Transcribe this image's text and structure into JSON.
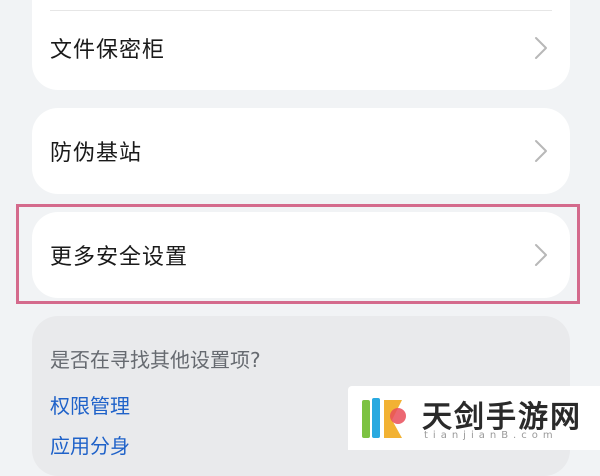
{
  "settings": {
    "items": [
      {
        "label": "文件保密柜"
      },
      {
        "label": "防伪基站"
      },
      {
        "label": "更多安全设置"
      }
    ]
  },
  "search": {
    "title": "是否在寻找其他设置项?",
    "links": [
      {
        "label": "权限管理"
      },
      {
        "label": "应用分身"
      }
    ]
  },
  "watermark": {
    "brand": "天剑手游网",
    "domain": "tianjianB.com"
  },
  "colors": {
    "highlight": "#d46a8c",
    "link": "#1f62c9"
  },
  "icons": {
    "chevron": "chevron-right-icon"
  }
}
